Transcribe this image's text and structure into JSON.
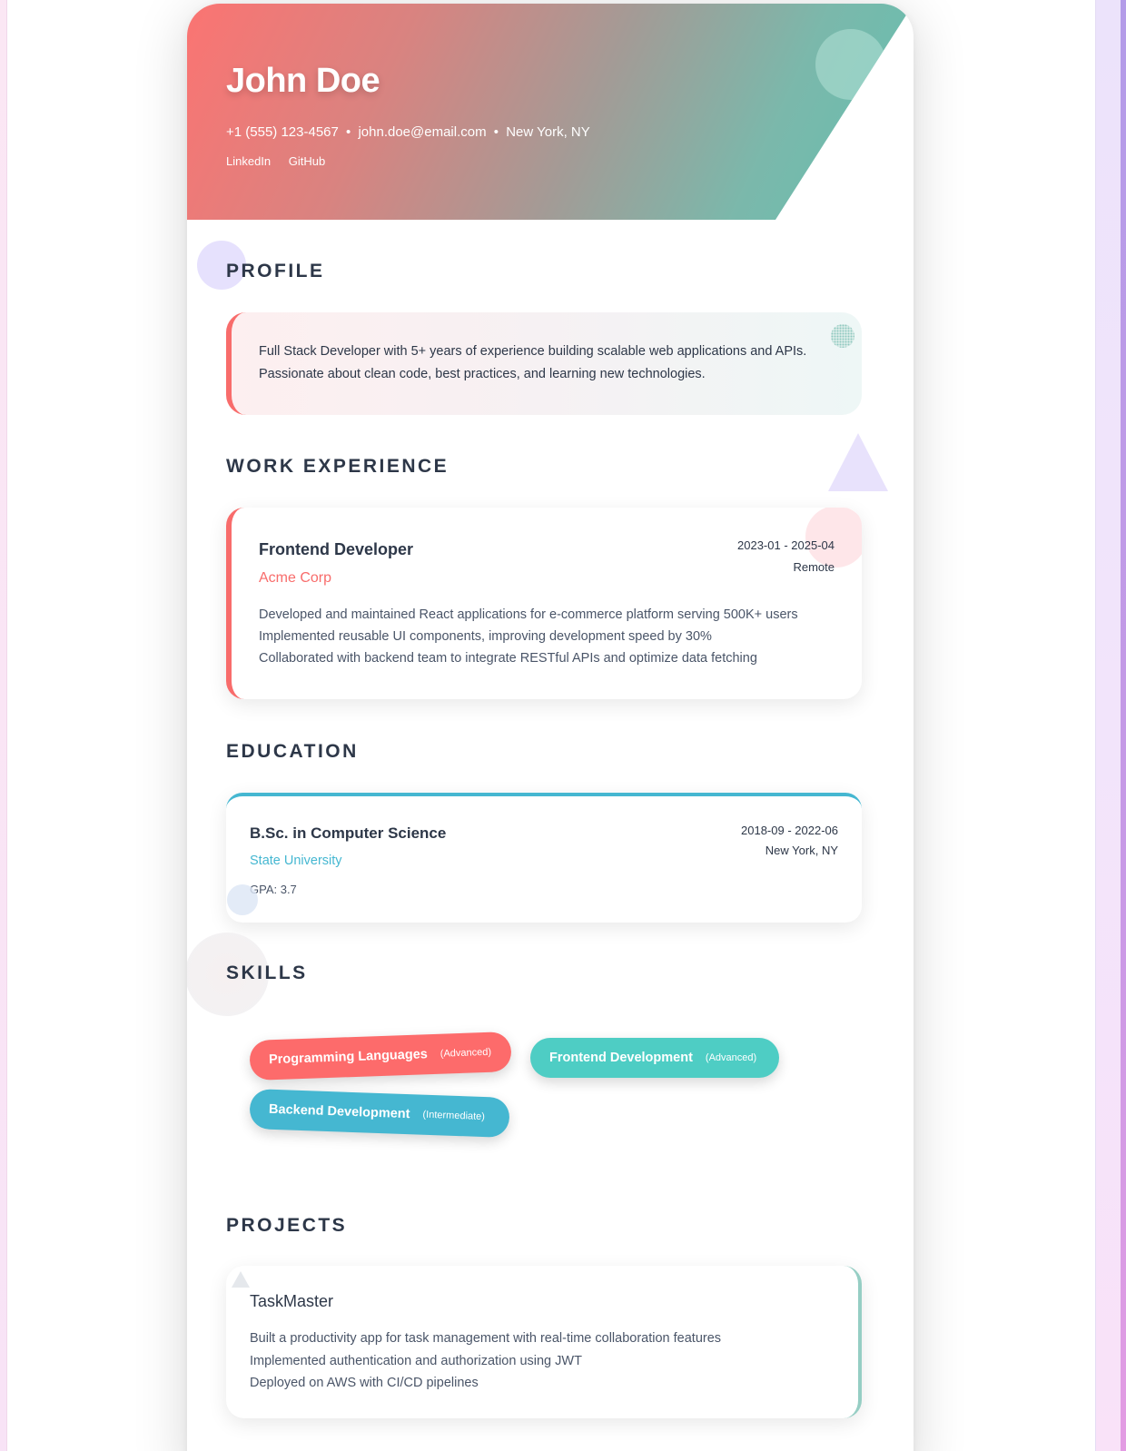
{
  "header": {
    "name": "John Doe",
    "phone": "+1 (555) 123-4567",
    "email": "john.doe@email.com",
    "location": "New York, NY",
    "separator": "•",
    "links": [
      "LinkedIn",
      "GitHub"
    ]
  },
  "sections": {
    "profile": "PROFILE",
    "work": "WORK EXPERIENCE",
    "education": "EDUCATION",
    "skills": "SKILLS",
    "projects": "PROJECTS"
  },
  "profile": {
    "summary_line1": "Full Stack Developer with 5+ years of experience building scalable web applications and APIs.",
    "summary_line2": "Passionate about clean code, best practices, and learning new technologies."
  },
  "work": [
    {
      "title": "Frontend Developer",
      "company": "Acme Corp",
      "dates": "2023-01 - 2025-04",
      "location": "Remote",
      "bullets": [
        "Developed and maintained React applications for e-commerce platform serving 500K+ users",
        "Implemented reusable UI components, improving development speed by 30%",
        "Collaborated with backend team to integrate RESTful APIs and optimize data fetching"
      ]
    }
  ],
  "education": [
    {
      "degree": "B.Sc. in Computer Science",
      "school": "State University",
      "dates": "2018-09 - 2022-06",
      "location": "New York, NY",
      "gpa": "GPA: 3.7"
    }
  ],
  "skills": [
    {
      "name": "Programming Languages",
      "level": "(Advanced)"
    },
    {
      "name": "Frontend Development",
      "level": "(Advanced)"
    },
    {
      "name": "Backend Development",
      "level": "(Intermediate)"
    }
  ],
  "projects": [
    {
      "title": "TaskMaster",
      "bullets": [
        "Built a productivity app for task management with real-time collaboration features",
        "Implemented authentication and authorization using JWT",
        "Deployed on AWS with CI/CD pipelines"
      ]
    }
  ],
  "colors": {
    "accent_red": "#f86c6b",
    "accent_teal": "#4ecdc4",
    "accent_blue": "#45b7d1",
    "text_dark": "#2d3748"
  }
}
